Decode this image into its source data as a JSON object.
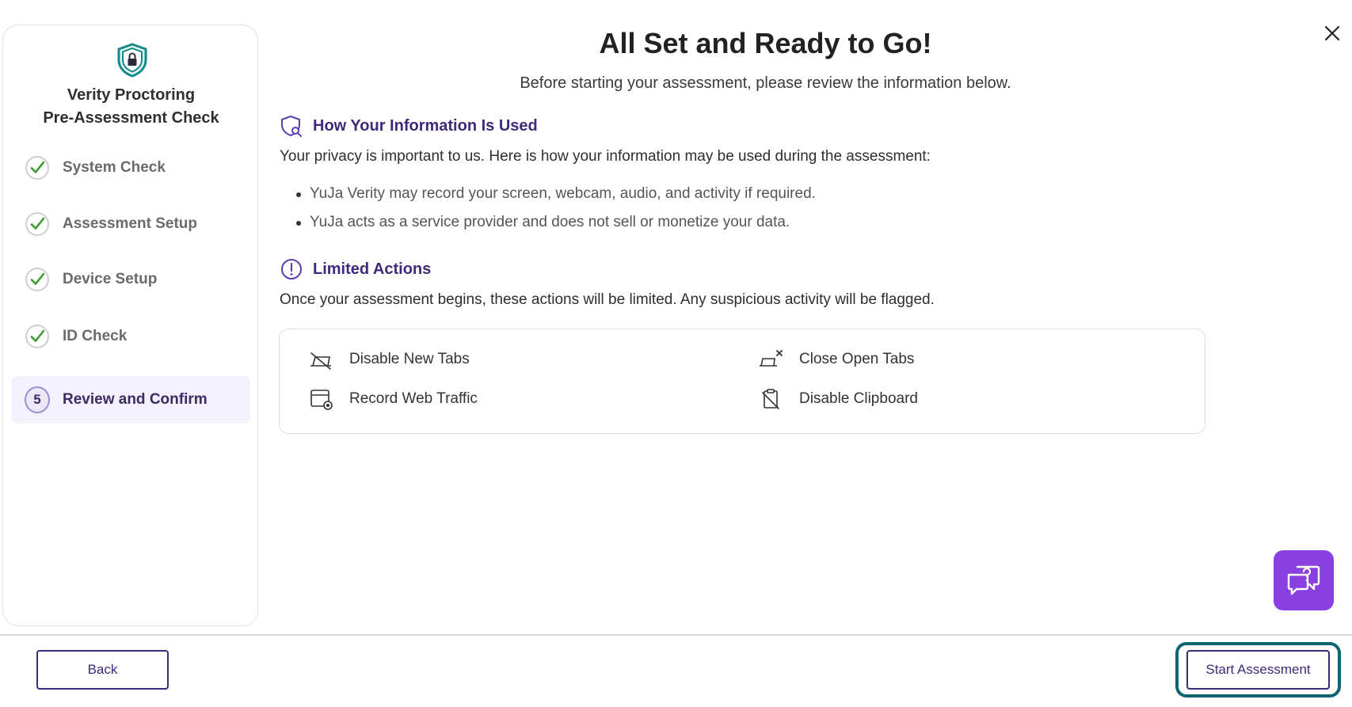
{
  "sidebar": {
    "title_line1": "Verity Proctoring",
    "title_line2": "Pre-Assessment Check",
    "steps": [
      {
        "label": "System Check",
        "status": "complete"
      },
      {
        "label": "Assessment Setup",
        "status": "complete"
      },
      {
        "label": "Device Setup",
        "status": "complete"
      },
      {
        "label": "ID Check",
        "status": "complete"
      },
      {
        "label": "Review and Confirm",
        "status": "active",
        "number": "5"
      }
    ]
  },
  "main": {
    "title": "All Set and Ready to Go!",
    "subtitle": "Before starting your assessment, please review the information below.",
    "info_section": {
      "heading": "How Your Information Is Used",
      "intro": "Your privacy is important to us. Here is how your information may be used during the assessment:",
      "bullets": [
        "YuJa Verity may record your screen, webcam, audio, and activity if required.",
        "YuJa acts as a service provider and does not sell or monetize your data."
      ]
    },
    "limited_section": {
      "heading": "Limited Actions",
      "intro": "Once your assessment begins, these actions will be limited. Any suspicious activity will be flagged.",
      "actions": [
        {
          "label": "Disable New Tabs",
          "icon": "tab-off-icon"
        },
        {
          "label": "Close Open Tabs",
          "icon": "tab-close-icon"
        },
        {
          "label": "Record Web Traffic",
          "icon": "browser-record-icon"
        },
        {
          "label": "Disable Clipboard",
          "icon": "clipboard-off-icon"
        }
      ]
    }
  },
  "footer": {
    "back_label": "Back",
    "start_label": "Start Assessment"
  },
  "colors": {
    "accent_purple": "#3e2a7a",
    "check_green": "#3a9a2a",
    "help_button": "#8a3fe0",
    "focus_ring": "#0e6470",
    "shield_teal": "#138a8a"
  }
}
